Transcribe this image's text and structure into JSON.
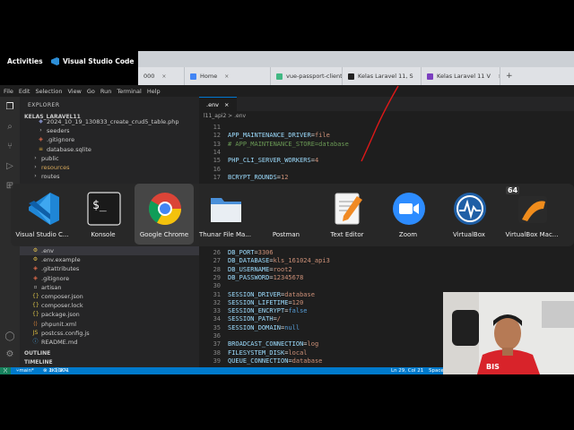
{
  "topbar": {
    "activities": "Activities",
    "app_name": "Visual Studio Code"
  },
  "browser": {
    "tabs": [
      {
        "label": "000",
        "color": "#888888"
      },
      {
        "label": "Home",
        "color": "#4285f4"
      },
      {
        "label": "vue-passport-client",
        "color": "#41b883"
      },
      {
        "label": "Kelas Laravel 11, S",
        "color": "#222222"
      },
      {
        "label": "Kelas Laravel 11 V",
        "color": "#7b3fbf"
      }
    ],
    "new_tab": "+"
  },
  "vscode": {
    "menu": [
      "File",
      "Edit",
      "Selection",
      "View",
      "Go",
      "Run",
      "Terminal",
      "Help"
    ],
    "explorer": {
      "header": "EXPLORER",
      "project": "KELAS_LARAVEL11",
      "items_top": [
        {
          "label": "2024_10_19_130833_create_crud5_table.php",
          "icon": "php",
          "indent": 1
        },
        {
          "label": "seeders",
          "icon": "folder",
          "indent": 1
        },
        {
          "label": ".gitignore",
          "icon": "git",
          "indent": 1
        },
        {
          "label": "database.sqlite",
          "icon": "db",
          "indent": 1
        },
        {
          "label": "public",
          "icon": "folder",
          "indent": 0
        },
        {
          "label": "resources",
          "icon": "folder",
          "indent": 0
        },
        {
          "label": "routes",
          "icon": "folder",
          "indent": 0
        }
      ],
      "items_bottom": [
        {
          "label": ".env",
          "icon": "gear",
          "indent": 0,
          "selected": true
        },
        {
          "label": ".env.example",
          "icon": "gear",
          "indent": 0
        },
        {
          "label": ".gitattributes",
          "icon": "git",
          "indent": 0
        },
        {
          "label": ".gitignore",
          "icon": "git",
          "indent": 0
        },
        {
          "label": "artisan",
          "icon": "file",
          "indent": 0
        },
        {
          "label": "composer.json",
          "icon": "json",
          "indent": 0
        },
        {
          "label": "composer.lock",
          "icon": "lock",
          "indent": 0
        },
        {
          "label": "package.json",
          "icon": "json",
          "indent": 0
        },
        {
          "label": "phpunit.xml",
          "icon": "xml",
          "indent": 0
        },
        {
          "label": "postcss.config.js",
          "icon": "js",
          "indent": 0
        },
        {
          "label": "README.md",
          "icon": "md",
          "indent": 0
        }
      ],
      "outline": "OUTLINE",
      "timeline": "TIMELINE"
    },
    "editor": {
      "tab": ".env",
      "breadcrumb": "l11_api2 > .env",
      "lines_top": [
        {
          "n": "11",
          "k": "",
          "v": ""
        },
        {
          "n": "12",
          "k": "APP_MAINTENANCE_DRIVER",
          "v": "file"
        },
        {
          "n": "13",
          "comment": "# APP_MAINTENANCE_STORE=database"
        },
        {
          "n": "14",
          "k": "",
          "v": ""
        },
        {
          "n": "15",
          "k": "PHP_CLI_SERVER_WORKERS",
          "v": "4"
        },
        {
          "n": "16",
          "k": "",
          "v": ""
        },
        {
          "n": "17",
          "k": "BCRYPT_ROUNDS",
          "v": "12"
        }
      ],
      "lines_bottom": [
        {
          "n": "26",
          "k": "DB_PORT",
          "v": "3306"
        },
        {
          "n": "27",
          "k": "DB_DATABASE",
          "v": "kls_161024_api3"
        },
        {
          "n": "28",
          "k": "DB_USERNAME",
          "v": "root2"
        },
        {
          "n": "29",
          "k": "DB_PASSWORD",
          "v": "12345678"
        },
        {
          "n": "30",
          "k": "",
          "v": ""
        },
        {
          "n": "31",
          "k": "SESSION_DRIVER",
          "v": "database"
        },
        {
          "n": "32",
          "k": "SESSION_LIFETIME",
          "v": "120"
        },
        {
          "n": "33",
          "k": "SESSION_ENCRYPT",
          "v": "false",
          "lit": true
        },
        {
          "n": "34",
          "k": "SESSION_PATH",
          "v": "/"
        },
        {
          "n": "35",
          "k": "SESSION_DOMAIN",
          "v": "null",
          "lit": true
        },
        {
          "n": "36",
          "k": "",
          "v": ""
        },
        {
          "n": "37",
          "k": "BROADCAST_CONNECTION",
          "v": "log"
        },
        {
          "n": "38",
          "k": "FILESYSTEM_DISK",
          "v": "local"
        },
        {
          "n": "39",
          "k": "QUEUE_CONNECTION",
          "v": "database"
        }
      ]
    },
    "status": {
      "branch": "main*",
      "problems": "1K",
      "warnings": "10K+",
      "info": "271",
      "position": "Ln 29, Col 21",
      "spaces": "Space"
    }
  },
  "switcher": {
    "apps": [
      {
        "label": "Visual Studio C...",
        "icon": "vscode-icon",
        "selected": false
      },
      {
        "label": "Konsole",
        "icon": "terminal-icon",
        "selected": false
      },
      {
        "label": "Google Chrome",
        "icon": "chrome-icon",
        "selected": true
      },
      {
        "label": "Thunar File Ma...",
        "icon": "folder-icon",
        "selected": false
      },
      {
        "label": "Postman",
        "icon": "postman-icon",
        "selected": false
      },
      {
        "label": "Text Editor",
        "icon": "text-editor-icon",
        "selected": false
      },
      {
        "label": "Zoom",
        "icon": "zoom-icon",
        "selected": false
      },
      {
        "label": "VirtualBox",
        "icon": "virtualbox-icon",
        "selected": false
      },
      {
        "label": "VirtualBox Mac...",
        "icon": "virtualbox-machine-icon",
        "selected": false,
        "badge": "64"
      }
    ]
  },
  "webcam": {
    "shirt_text": "BIS"
  }
}
